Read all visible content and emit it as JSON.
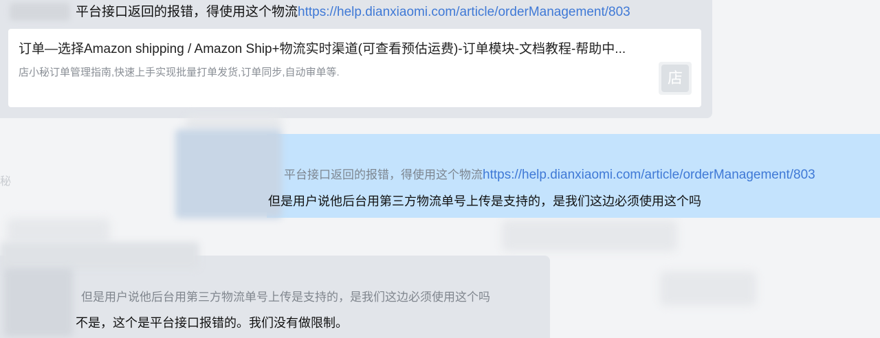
{
  "messages": [
    {
      "id": "msg-1",
      "text": "平台接口返回的报错，得使用这个物流",
      "link": "https://help.dianxiaomi.com/article/orderManagement/803",
      "link_card": {
        "title": "订单—选择Amazon shipping / Amazon Ship+物流实时渠道(可查看预估运费)-订单模块-文档教程-帮助中...",
        "description": "店小秘订单管理指南,快速上手实现批量打单发货,订单同步,自动审单等.",
        "logo_char": "店"
      }
    },
    {
      "id": "msg-2",
      "quote_text": "平台接口返回的报错，得使用这个物流",
      "quote_link": "https://help.dianxiaomi.com/article/orderManagement/803",
      "text": "但是用户说他后台用第三方物流单号上传是支持的，是我们这边必须使用这个吗"
    },
    {
      "id": "msg-3",
      "quote_text": "但是用户说他后台用第三方物流单号上传是支持的，是我们这边必须使用这个吗",
      "text": "不是，这个是平台接口报错的。我们没有做限制。"
    }
  ],
  "side_fragment": "秘",
  "colors": {
    "incoming_bubble": "#e2e5ea",
    "outgoing_bubble": "#c4e3fd",
    "link": "#3f79d6",
    "muted_text": "#8a8f96"
  }
}
